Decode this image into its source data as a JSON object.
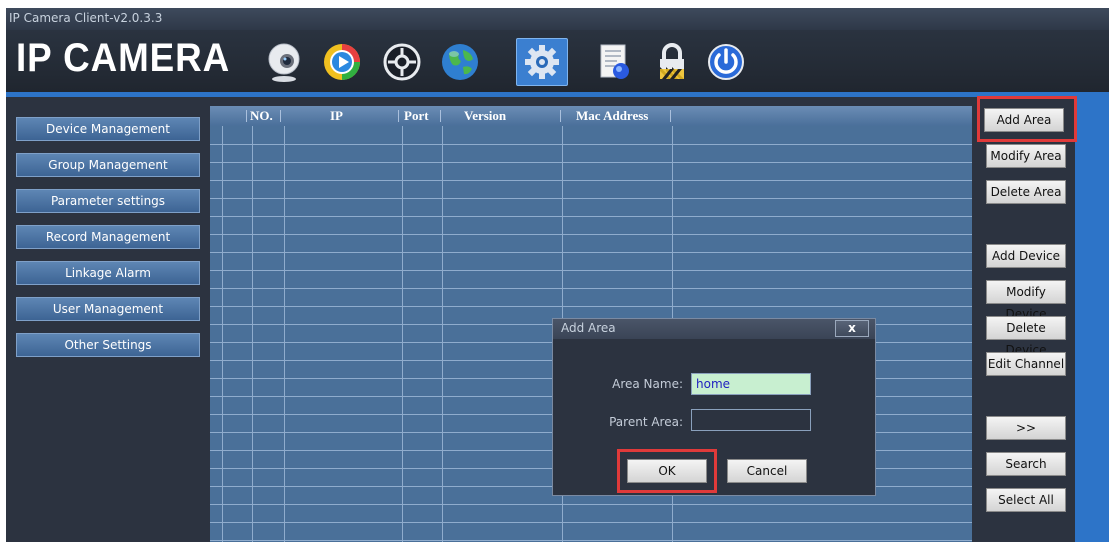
{
  "window": {
    "title": "IP Camera Client-v2.0.3.3"
  },
  "header": {
    "logo": "IP CAMERA"
  },
  "toolbar": {
    "icons": [
      "webcam-icon",
      "playback-icon",
      "ptz-icon",
      "globe-icon",
      "settings-icon",
      "log-icon",
      "lock-icon",
      "power-icon"
    ],
    "active": "settings-icon"
  },
  "sidebar": {
    "items": [
      {
        "label": "Device Management"
      },
      {
        "label": "Group Management"
      },
      {
        "label": "Parameter settings"
      },
      {
        "label": "Record Management"
      },
      {
        "label": "Linkage Alarm"
      },
      {
        "label": "User Management"
      },
      {
        "label": "Other Settings"
      }
    ]
  },
  "table": {
    "columns": [
      "NO.",
      "IP",
      "Port",
      "Version",
      "Mac Address"
    ],
    "rows": []
  },
  "actions": {
    "add_area": "Add Area",
    "modify_area": "Modify Area",
    "delete_area": "Delete Area",
    "add_device": "Add Device",
    "modify_device": "Modify Device",
    "delete_device": "Delete Device",
    "edit_channel": "Edit Channel",
    "more": ">>",
    "search": "Search",
    "select_all": "Select All"
  },
  "dialog": {
    "title": "Add Area",
    "close": "x",
    "area_name_label": "Area Name:",
    "area_name_value": "home",
    "parent_area_label": "Parent Area:",
    "parent_area_value": "",
    "ok": "OK",
    "cancel": "Cancel"
  },
  "colors": {
    "background": "#2c3340",
    "accent_blue": "#2d74c8",
    "table_bg": "#4a7099",
    "highlight_red": "#e03a3a",
    "input_green": "#c8efd0"
  }
}
